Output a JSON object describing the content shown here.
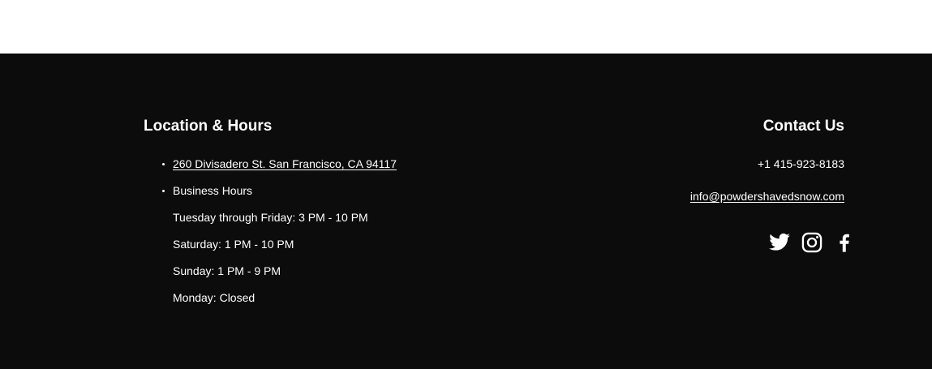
{
  "footer": {
    "location": {
      "heading": "Location & Hours",
      "address": "260 Divisadero St. San Francisco, CA 94117",
      "hours_label": "Business Hours",
      "hours": [
        "Tuesday through Friday: 3 PM - 10 PM",
        "Saturday: 1 PM - 10 PM",
        "Sunday: 1 PM - 9 PM",
        "Monday: Closed"
      ]
    },
    "contact": {
      "heading": "Contact Us",
      "phone": "+1 415-923-8183",
      "email": "info@powdershavedsnow.com",
      "social_icons": [
        "twitter-icon",
        "instagram-icon",
        "facebook-icon"
      ]
    }
  },
  "colors": {
    "footer_background": "#0d0c0c",
    "text": "#ffffff",
    "page_background": "#ffffff"
  }
}
